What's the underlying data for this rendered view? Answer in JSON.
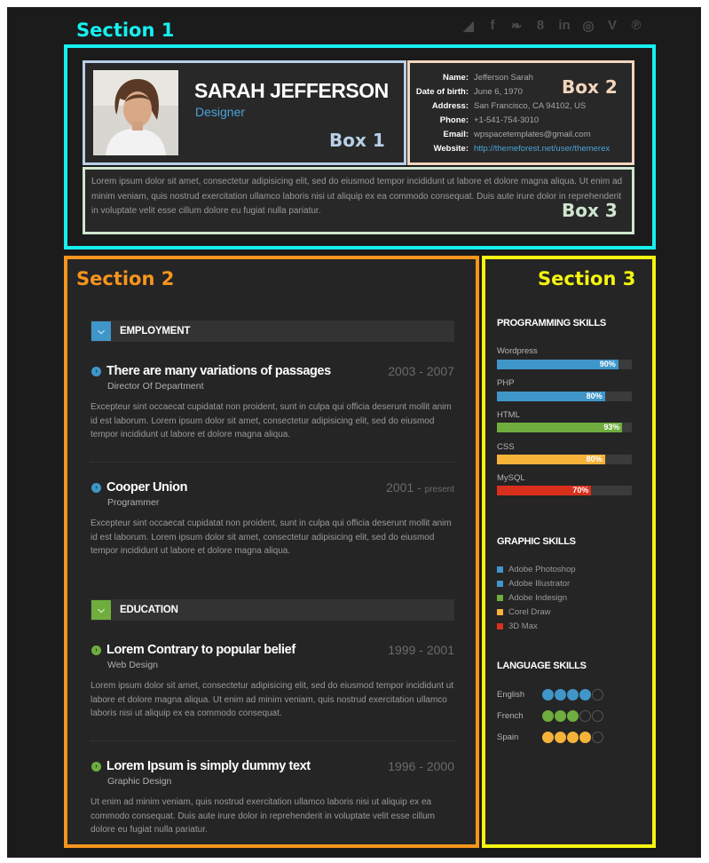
{
  "annotations": {
    "section1": "Section 1",
    "section2": "Section 2",
    "section3": "Section 3",
    "box1": "Box 1",
    "box2": "Box 2",
    "box3": "Box 3"
  },
  "colors": {
    "section1": "#16f0f0",
    "section2": "#f7941d",
    "section3": "#f5f510",
    "box1": "#b9cfe7",
    "box2": "#f2d5bd",
    "box3": "#cfe5cf",
    "blue": "#3f96c9",
    "green": "#6fae3e",
    "orange": "#f5b33a",
    "red": "#d9301e"
  },
  "social_icons": [
    "rss-icon",
    "facebook-icon",
    "twitter-icon",
    "googleplus-icon",
    "linkedin-icon",
    "dribbble-icon",
    "vimeo-icon",
    "pinterest-icon"
  ],
  "profile": {
    "name": "SARAH JEFFERSON",
    "role": "Designer",
    "info": [
      {
        "key": "Name:",
        "value": "Jefferson Sarah"
      },
      {
        "key": "Date of birth:",
        "value": "June 6, 1970"
      },
      {
        "key": "Address:",
        "value": "San Francisco, CA 94102, US"
      },
      {
        "key": "Phone:",
        "value": "+1-541-754-3010"
      },
      {
        "key": "Email:",
        "value": "wpspacetemplates@gmail.com"
      },
      {
        "key": "Website:",
        "value": "http://themeforest.net/user/themerex"
      }
    ],
    "bio": "Lorem ipsum dolor sit amet, consectetur adipisicing elit, sed do eiusmod tempor incididunt ut labore et dolore magna aliqua. Ut enim ad minim veniam, quis nostrud exercitation ullamco laboris nisi ut aliquip ex ea commodo consequat. Duis aute irure dolor in reprehenderit in voluptate velit esse cillum dolore eu fugiat nulla pariatur."
  },
  "employment": {
    "label": "EMPLOYMENT",
    "entries": [
      {
        "title": "There are many variations of passages",
        "date": "2003 - 2007",
        "sub": "Director Of Department",
        "desc": "Excepteur sint occaecat cupidatat non proident, sunt in culpa qui officia deserunt mollit anim id est laborum. Lorem ipsum dolor sit amet, consectetur adipisicing elit, sed do eiusmod tempor incididunt ut labore et dolore magna aliqua."
      },
      {
        "title": "Cooper Union",
        "date_start": "2001 - ",
        "date_end": "present",
        "sub": "Programmer",
        "desc": "Excepteur sint occaecat cupidatat non proident, sunt in culpa qui officia deserunt mollit anim id est laborum. Lorem ipsum dolor sit amet, consectetur adipisicing elit, sed do eiusmod tempor incididunt ut labore et dolore magna aliqua."
      }
    ]
  },
  "education": {
    "label": "EDUCATION",
    "entries": [
      {
        "title": "Lorem Contrary to popular belief",
        "date": "1999 - 2001",
        "sub": "Web Design",
        "desc": "Lorem ipsum dolor sit amet, consectetur adipisicing elit, sed do eiusmod tempor incididunt ut labore et dolore magna aliqua. Ut enim ad minim veniam, quis nostrud exercitation ullamco laboris nisi ut aliquip ex ea commodo consequat."
      },
      {
        "title": "Lorem Ipsum is simply dummy text",
        "date": "1996 - 2000",
        "sub": "Graphic Design",
        "desc": "Ut enim ad minim veniam, quis nostrud exercitation ullamco laboris nisi ut aliquip ex ea commodo consequat. Duis aute irure dolor in reprehenderit in voluptate velit esse cillum dolore eu fugiat nulla pariatur."
      }
    ]
  },
  "programming_skills": {
    "heading": "PROGRAMMING SKILLS",
    "items": [
      {
        "label": "Wordpress",
        "value": 90,
        "text": "90%",
        "color": "#3f96c9"
      },
      {
        "label": "PHP",
        "value": 80,
        "text": "80%",
        "color": "#3f96c9"
      },
      {
        "label": "HTML",
        "value": 93,
        "text": "93%",
        "color": "#6fae3e"
      },
      {
        "label": "CSS",
        "value": 80,
        "text": "80%",
        "color": "#f5b33a"
      },
      {
        "label": "MySQL",
        "value": 70,
        "text": "70%",
        "color": "#d9301e"
      }
    ]
  },
  "graphic_skills": {
    "heading": "GRAPHIC SKILLS",
    "items": [
      {
        "label": "Adobe Photoshop",
        "color": "#3f96c9"
      },
      {
        "label": "Adobe Illustrator",
        "color": "#3f96c9"
      },
      {
        "label": "Adobe Indesign",
        "color": "#6fae3e"
      },
      {
        "label": "Corel Draw",
        "color": "#f5b33a"
      },
      {
        "label": "3D Max",
        "color": "#d9301e"
      }
    ]
  },
  "language_skills": {
    "heading": "LANGUAGE SKILLS",
    "items": [
      {
        "label": "English",
        "level": 4,
        "max": 5,
        "color": "#3f96c9"
      },
      {
        "label": "French",
        "level": 3,
        "max": 5,
        "color": "#6fae3e"
      },
      {
        "label": "Spain",
        "level": 4,
        "max": 5,
        "color": "#f5b33a"
      }
    ]
  }
}
